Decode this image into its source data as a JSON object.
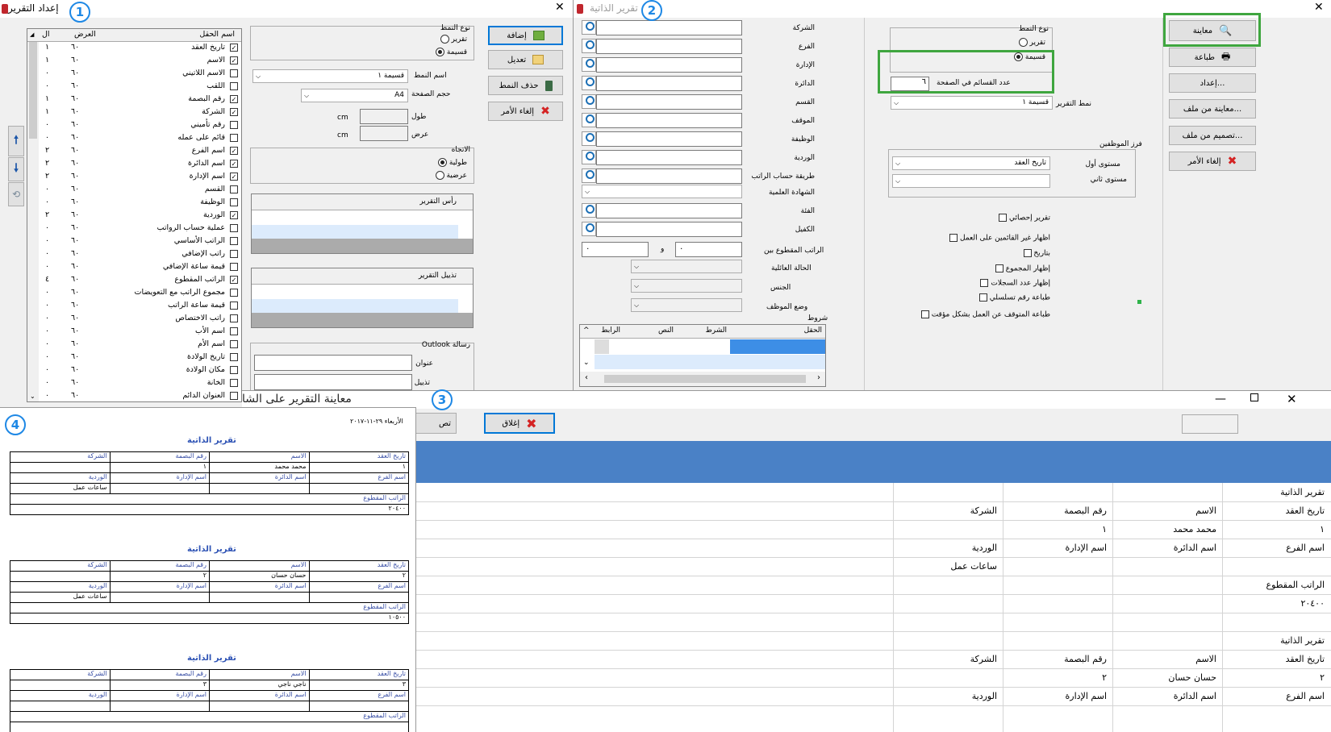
{
  "badges": [
    "1",
    "2",
    "3",
    "4"
  ],
  "win1": {
    "title": "إعداد التقرير",
    "cols": {
      "name": "اسم الحقل",
      "width": "العرض",
      "order": "ال"
    },
    "fields": [
      {
        "name": "تاريخ العقد",
        "w": "٦٠",
        "o": "١",
        "c": true
      },
      {
        "name": "الاسم",
        "w": "٦٠",
        "o": "١",
        "c": true
      },
      {
        "name": "الاسم اللاتيني",
        "w": "٦٠",
        "o": "٠",
        "c": false
      },
      {
        "name": "اللقب",
        "w": "٦٠",
        "o": "٠",
        "c": false
      },
      {
        "name": "رقم البصمة",
        "w": "٦٠",
        "o": "١",
        "c": true
      },
      {
        "name": "الشركة",
        "w": "٦٠",
        "o": "١",
        "c": true
      },
      {
        "name": "رقم تأميني",
        "w": "٦٠",
        "o": "٠",
        "c": false
      },
      {
        "name": "قائم على عمله",
        "w": "٦٠",
        "o": "٠",
        "c": false
      },
      {
        "name": "اسم الفرع",
        "w": "٦٠",
        "o": "٢",
        "c": true
      },
      {
        "name": "اسم الدائرة",
        "w": "٦٠",
        "o": "٢",
        "c": true
      },
      {
        "name": "اسم الإدارة",
        "w": "٦٠",
        "o": "٢",
        "c": true
      },
      {
        "name": "القسم",
        "w": "٦٠",
        "o": "٠",
        "c": false
      },
      {
        "name": "الوظيفة",
        "w": "٦٠",
        "o": "٠",
        "c": false
      },
      {
        "name": "الوردية",
        "w": "٦٠",
        "o": "٢",
        "c": true
      },
      {
        "name": "عملية حساب الرواتب",
        "w": "٦٠",
        "o": "٠",
        "c": false
      },
      {
        "name": "الراتب الأساسي",
        "w": "٦٠",
        "o": "٠",
        "c": false
      },
      {
        "name": "راتب الإضافي",
        "w": "٦٠",
        "o": "٠",
        "c": false
      },
      {
        "name": "قيمة ساعة الإضافي",
        "w": "٦٠",
        "o": "٠",
        "c": false
      },
      {
        "name": "الراتب المقطوع",
        "w": "٦٠",
        "o": "٤",
        "c": true
      },
      {
        "name": "مجموع الراتب مع التعويضات",
        "w": "٦٠",
        "o": "٠",
        "c": false
      },
      {
        "name": "قيمة ساعة الراتب",
        "w": "٦٠",
        "o": "٠",
        "c": false
      },
      {
        "name": "راتب الاختصاص",
        "w": "٦٠",
        "o": "٠",
        "c": false
      },
      {
        "name": "اسم الأب",
        "w": "٦٠",
        "o": "٠",
        "c": false
      },
      {
        "name": "اسم الأم",
        "w": "٦٠",
        "o": "٠",
        "c": false
      },
      {
        "name": "تاريخ الولادة",
        "w": "٦٠",
        "o": "٠",
        "c": false
      },
      {
        "name": "مكان الولادة",
        "w": "٦٠",
        "o": "٠",
        "c": false
      },
      {
        "name": "الخانة",
        "w": "٦٠",
        "o": "٠",
        "c": false
      },
      {
        "name": "العنوان الدائم",
        "w": "٦٠",
        "o": "٠",
        "c": false
      }
    ],
    "pattern_type_label": "نوع النمط",
    "report_opt": "تقرير",
    "coupon_opt": "قسيمة",
    "pattern_name_label": "اسم النمط",
    "pattern_name_value": "قسيمة ١",
    "page_size_label": "حجم الصفحة",
    "page_size_value": "A4",
    "length_label": "طول",
    "width_label": "عرض",
    "unit": "cm",
    "direction_label": "الاتجاه",
    "portrait": "طولية",
    "landscape": "عرضية",
    "header_label": "رأس التقرير",
    "footer_label": "تذييل التقرير",
    "outlook_label": "رسالة Outlook",
    "subject_label": "عنوان",
    "footer2_label": "تذييل",
    "add_btn": "إضافة",
    "edit_btn": "تعديل",
    "delete_btn": "حذف النمط",
    "cancel_btn": "إلغاء الأمر"
  },
  "win2": {
    "title": "تقرير الذاتية",
    "fields": [
      "الشركة",
      "الفرع",
      "الإدارة",
      "الدائرة",
      "القسم",
      "الموقف",
      "الوظيفة",
      "الوردية",
      "طريقة حساب الراتب",
      "الشهادة العلمية",
      "الفئة",
      "الكفيل"
    ],
    "salary_between": "الراتب المقطوع بين",
    "and": "و",
    "zero": "٠",
    "family": "الحالة العائلية",
    "gender": "الجنس",
    "emp_status": "وضع الموظف",
    "conditions": "شروط",
    "cond_cols": [
      "الحقل",
      "الشرط",
      "النص",
      "الرابط"
    ],
    "pattern_type_label": "نوع النمط",
    "report_opt": "تقرير",
    "coupon_opt": "قسيمة",
    "sections_label": "عدد القسائم في الصفحة",
    "sections_value": "٦",
    "report_pattern_label": "نمط التقرير",
    "report_pattern_value": "قسيمة ١",
    "sort_label": "فرز الموظفين",
    "level1_label": "مستوى أول",
    "level1_value": "تاريخ العقد",
    "level2_label": "مستوى ثاني",
    "checks": [
      "تقرير إحصائي",
      "اظهار غير القائمين على العمل",
      "بتاريخ",
      "إظهار المجموع",
      "إظهار عدد السجلات",
      "طباعة رقم تسلسلي",
      "طباعة المتوقف عن العمل بشكل مؤقت"
    ],
    "preview_btn": "معاينة",
    "print_btn": "طباعة",
    "setup_btn": "إعداد...",
    "preview_file_btn": "معاينة من ملف...",
    "design_file_btn": "تصميم من ملف...",
    "cancel_btn": "إلغاء الأمر"
  },
  "win3": {
    "title": "معاينة التقرير على الشا",
    "close_btn": "إغلاق",
    "partial_btn": "تص",
    "rows": [
      [
        "تقرير الذاتية",
        "",
        "",
        ""
      ],
      [
        "تاريخ العقد",
        "الاسم",
        "رقم البصمة",
        "الشركة"
      ],
      [
        "١",
        "محمد محمد",
        "١",
        ""
      ],
      [
        "اسم الفرع",
        "اسم الدائرة",
        "اسم الإدارة",
        "الوردية"
      ],
      [
        "",
        "",
        "",
        "ساعات عمل"
      ],
      [
        "الراتب المقطوع",
        "",
        "",
        ""
      ],
      [
        "٢٠٤٠٠",
        "",
        "",
        ""
      ],
      [
        "",
        "",
        "",
        ""
      ],
      [
        "تقرير الذاتية",
        "",
        "",
        ""
      ],
      [
        "تاريخ العقد",
        "الاسم",
        "رقم البصمة",
        "الشركة"
      ],
      [
        "٢",
        "حسان حسان",
        "٢",
        ""
      ],
      [
        "اسم الفرع",
        "اسم الدائرة",
        "اسم الإدارة",
        "الوردية"
      ]
    ]
  },
  "win4": {
    "date": "الأربعاء ٢٩-١١-٢٠١٧",
    "title": "تقرير الذاتية",
    "h1": [
      "تاريخ العقد",
      "الاسم",
      "رقم البصمة",
      "الشركة"
    ],
    "h2": [
      "اسم الفرع",
      "اسم الدائرة",
      "اسم الإدارة",
      "الوردية"
    ],
    "salary": "الراتب المقطوع",
    "records": [
      {
        "num": "١",
        "name": "محمد محمد",
        "fp": "١",
        "shift": "ساعات عمل",
        "salary": "٢٠٤٠٠"
      },
      {
        "num": "٢",
        "name": "حسان حسان",
        "fp": "٢",
        "shift": "ساعات عمل",
        "salary": "١٠٥٠٠"
      },
      {
        "num": "٣",
        "name": "ناجي ناجي",
        "fp": "٣",
        "shift": "",
        "salary": ""
      }
    ]
  }
}
